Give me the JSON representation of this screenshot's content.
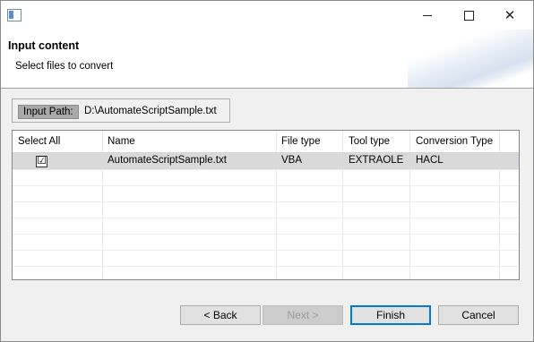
{
  "window": {
    "title": "",
    "controls": {
      "minimize": "minimize-icon",
      "maximize": "maximize-icon",
      "close": "✕"
    }
  },
  "header": {
    "title": "Input content",
    "subtitle": "Select files to convert"
  },
  "input_path": {
    "label": "Input Path:",
    "value": "D:\\AutomateScriptSample.txt"
  },
  "table": {
    "columns": [
      "Select All",
      "Name",
      "File type",
      "Tool type",
      "Conversion Type"
    ],
    "rows": [
      {
        "checked": "☑",
        "name": "AutomateScriptSample.txt",
        "file_type": "VBA",
        "tool_type": "EXTRAOLE",
        "conversion_type": "HACL"
      }
    ]
  },
  "buttons": {
    "back": "< Back",
    "next": "Next >",
    "finish": "Finish",
    "cancel": "Cancel"
  },
  "colors": {
    "selected_row": "#d9d9d9",
    "focus_border": "#0078d7"
  }
}
